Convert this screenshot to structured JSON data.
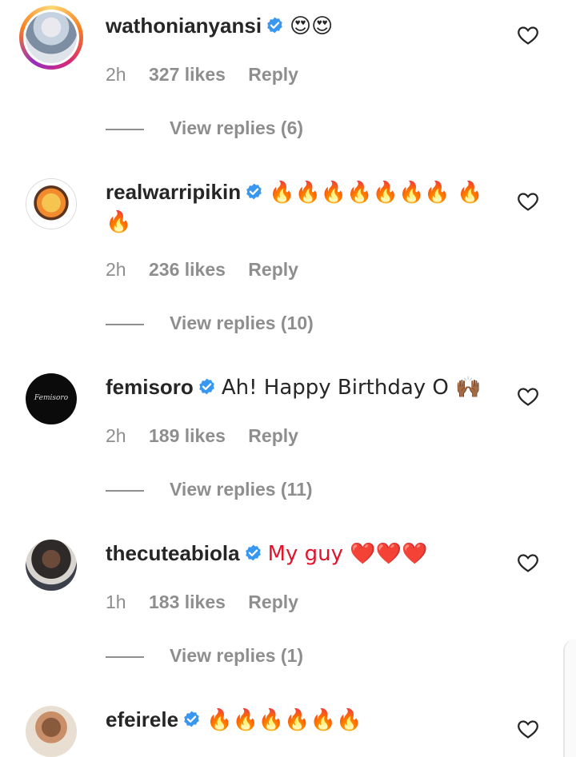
{
  "comments": [
    {
      "username": "wathonianyansi",
      "text": "😍😍",
      "time": "2h",
      "likes": "327 likes",
      "reply": "Reply",
      "view_replies": "View replies (6)"
    },
    {
      "username": "realwarripikin",
      "text": "🔥🔥🔥🔥🔥🔥🔥 🔥🔥",
      "time": "2h",
      "likes": "236 likes",
      "reply": "Reply",
      "view_replies": "View replies (10)"
    },
    {
      "username": "femisoro",
      "text": "Ah! Happy Birthday O 🙌🏾",
      "time": "2h",
      "likes": "189 likes",
      "reply": "Reply",
      "view_replies": "View replies (11)"
    },
    {
      "username": "thecuteabiola",
      "text": "My guy ❤️❤️❤️",
      "time": "1h",
      "likes": "183 likes",
      "reply": "Reply",
      "view_replies": "View replies (1)"
    },
    {
      "username": "efeirele",
      "text": "🔥🔥🔥🔥🔥🔥"
    }
  ],
  "colors": {
    "verified": "#3897f0",
    "secondary_text": "#8e8e8e",
    "primary_text": "#262626"
  },
  "icons": {
    "verified": "verified-badge-icon",
    "like": "heart-outline-icon"
  }
}
